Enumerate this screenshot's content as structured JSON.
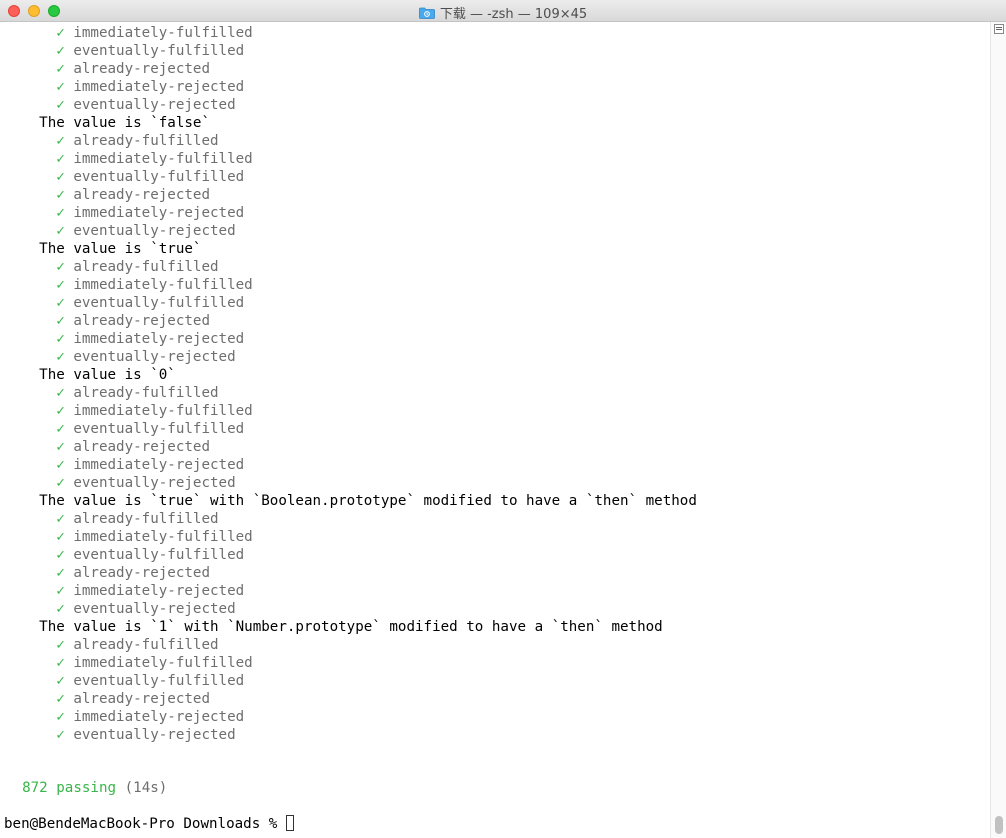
{
  "window": {
    "title": "下载 — -zsh — 109×45"
  },
  "colors": {
    "pass_green": "#39b54a",
    "muted_gray": "#6e6e6e"
  },
  "terminal": {
    "check_glyph": "✓",
    "lines": [
      {
        "type": "pass",
        "text": "immediately-fulfilled"
      },
      {
        "type": "pass",
        "text": "eventually-fulfilled"
      },
      {
        "type": "pass",
        "text": "already-rejected"
      },
      {
        "type": "pass",
        "text": "immediately-rejected"
      },
      {
        "type": "pass",
        "text": "eventually-rejected"
      },
      {
        "type": "heading",
        "text": "The value is `false`"
      },
      {
        "type": "pass",
        "text": "already-fulfilled"
      },
      {
        "type": "pass",
        "text": "immediately-fulfilled"
      },
      {
        "type": "pass",
        "text": "eventually-fulfilled"
      },
      {
        "type": "pass",
        "text": "already-rejected"
      },
      {
        "type": "pass",
        "text": "immediately-rejected"
      },
      {
        "type": "pass",
        "text": "eventually-rejected"
      },
      {
        "type": "heading",
        "text": "The value is `true`"
      },
      {
        "type": "pass",
        "text": "already-fulfilled"
      },
      {
        "type": "pass",
        "text": "immediately-fulfilled"
      },
      {
        "type": "pass",
        "text": "eventually-fulfilled"
      },
      {
        "type": "pass",
        "text": "already-rejected"
      },
      {
        "type": "pass",
        "text": "immediately-rejected"
      },
      {
        "type": "pass",
        "text": "eventually-rejected"
      },
      {
        "type": "heading",
        "text": "The value is `0`"
      },
      {
        "type": "pass",
        "text": "already-fulfilled"
      },
      {
        "type": "pass",
        "text": "immediately-fulfilled"
      },
      {
        "type": "pass",
        "text": "eventually-fulfilled"
      },
      {
        "type": "pass",
        "text": "already-rejected"
      },
      {
        "type": "pass",
        "text": "immediately-rejected"
      },
      {
        "type": "pass",
        "text": "eventually-rejected"
      },
      {
        "type": "heading",
        "text": "The value is `true` with `Boolean.prototype` modified to have a `then` method"
      },
      {
        "type": "pass",
        "text": "already-fulfilled"
      },
      {
        "type": "pass",
        "text": "immediately-fulfilled"
      },
      {
        "type": "pass",
        "text": "eventually-fulfilled"
      },
      {
        "type": "pass",
        "text": "already-rejected"
      },
      {
        "type": "pass",
        "text": "immediately-rejected"
      },
      {
        "type": "pass",
        "text": "eventually-rejected"
      },
      {
        "type": "heading",
        "text": "The value is `1` with `Number.prototype` modified to have a `then` method"
      },
      {
        "type": "pass",
        "text": "already-fulfilled"
      },
      {
        "type": "pass",
        "text": "immediately-fulfilled"
      },
      {
        "type": "pass",
        "text": "eventually-fulfilled"
      },
      {
        "type": "pass",
        "text": "already-rejected"
      },
      {
        "type": "pass",
        "text": "immediately-rejected"
      },
      {
        "type": "pass",
        "text": "eventually-rejected"
      }
    ],
    "summary": {
      "passing": "872 passing",
      "duration": "(14s)"
    },
    "prompt": "ben@BendeMacBook-Pro Downloads % "
  }
}
